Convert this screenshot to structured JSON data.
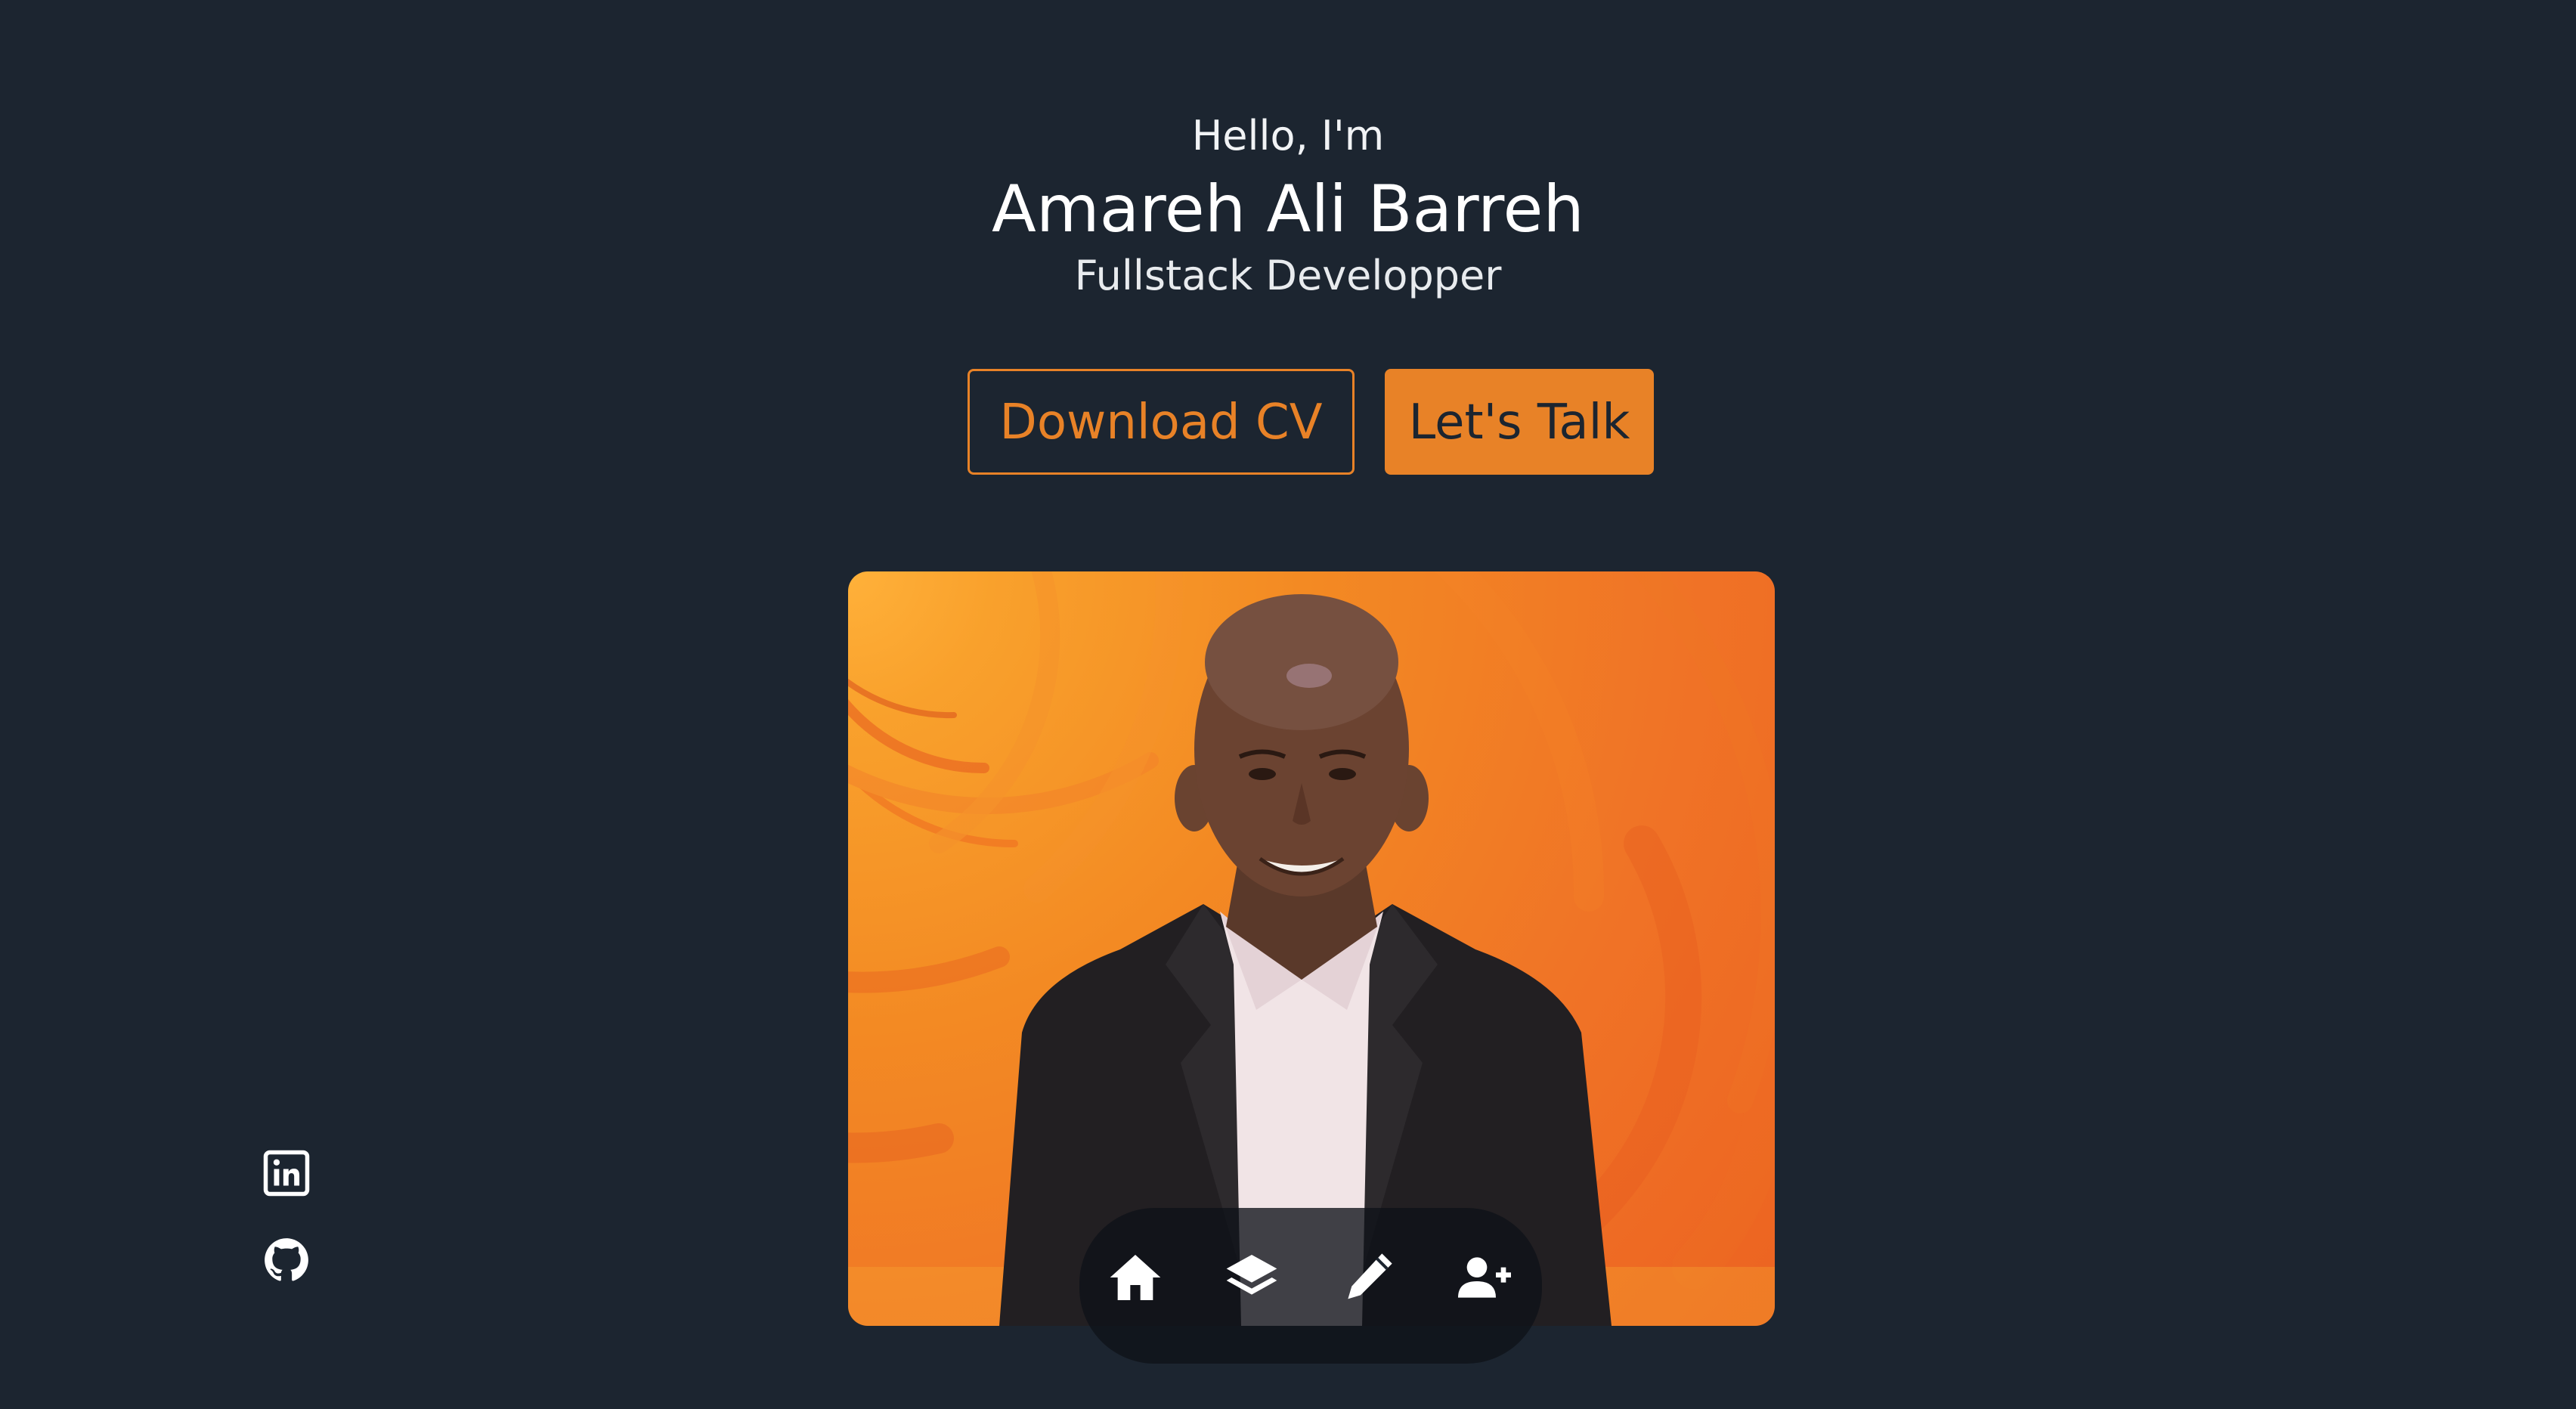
{
  "hero": {
    "greeting": "Hello, I'm",
    "name": "Amareh Ali Barreh",
    "role": "Fullstack Developper"
  },
  "buttons": {
    "download_cv": "Download CV",
    "lets_talk": "Let's Talk"
  },
  "colors": {
    "background": "#1c2530",
    "accent": "#e88227",
    "text": "#ffffff"
  },
  "nav": {
    "items": [
      {
        "icon": "home-icon"
      },
      {
        "icon": "layers-icon"
      },
      {
        "icon": "pencil-icon"
      },
      {
        "icon": "user-plus-icon"
      }
    ]
  },
  "socials": [
    {
      "icon": "linkedin-icon"
    },
    {
      "icon": "github-icon"
    }
  ]
}
